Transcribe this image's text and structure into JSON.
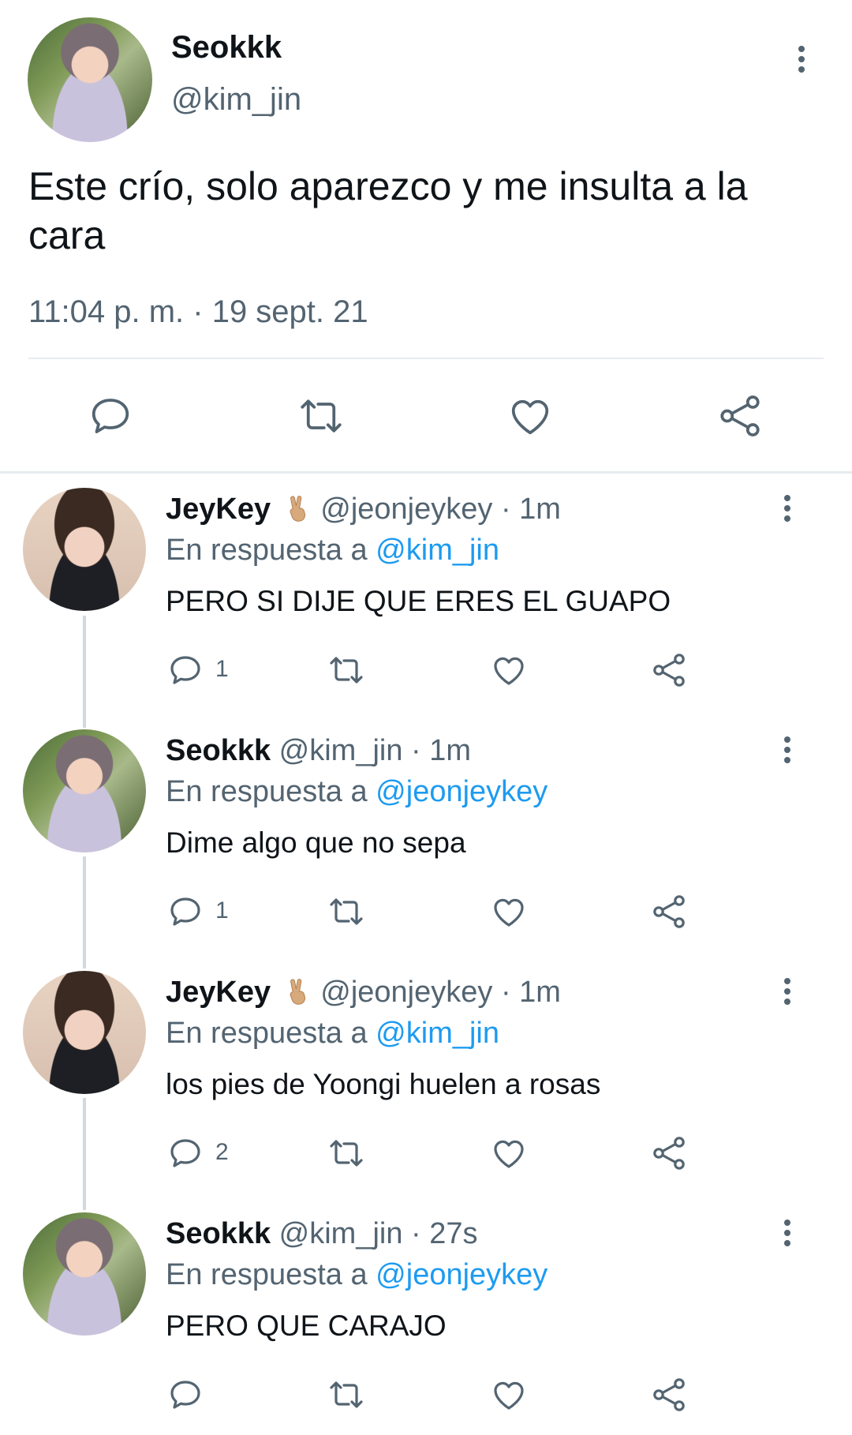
{
  "main_tweet": {
    "display_name": "Seokkk",
    "handle": "@kim_jin",
    "text": "Este crío, solo aparezco y me insulta a la cara",
    "timestamp": "11:04 p. m. · 19 sept. 21",
    "actions": [
      "reply-icon",
      "retweet-icon",
      "like-icon",
      "share-icon"
    ]
  },
  "replies": [
    {
      "display_name": "JeyKey",
      "emoji": "✌",
      "handle": "@jeonjeykey",
      "time": "· 1m",
      "reply_to_prefix": "En respuesta a",
      "reply_to": "@kim_jin",
      "text": "PERO SI DIJE QUE ERES EL GUAPO",
      "reply_count": "1"
    },
    {
      "display_name": "Seokkk",
      "handle": "@kim_jin",
      "time": "· 1m",
      "reply_to_prefix": "En respuesta a",
      "reply_to": "@jeonjeykey",
      "text": "Dime algo que no sepa",
      "reply_count": "1"
    },
    {
      "display_name": "JeyKey",
      "emoji": "✌",
      "handle": "@jeonjeykey",
      "time": "· 1m",
      "reply_to_prefix": "En respuesta a",
      "reply_to": "@kim_jin",
      "text": "los pies de Yoongi huelen a rosas",
      "reply_count": "2"
    },
    {
      "display_name": "Seokkk",
      "handle": "@kim_jin",
      "time": "· 27s",
      "reply_to_prefix": "En respuesta a",
      "reply_to": "@jeonjeykey",
      "text": "PERO QUE CARAJO",
      "reply_count": ""
    }
  ],
  "colors": {
    "text": "#0f1419",
    "secondary": "#536471",
    "mention": "#1d9bf0",
    "divider": "#e6ecf0"
  }
}
